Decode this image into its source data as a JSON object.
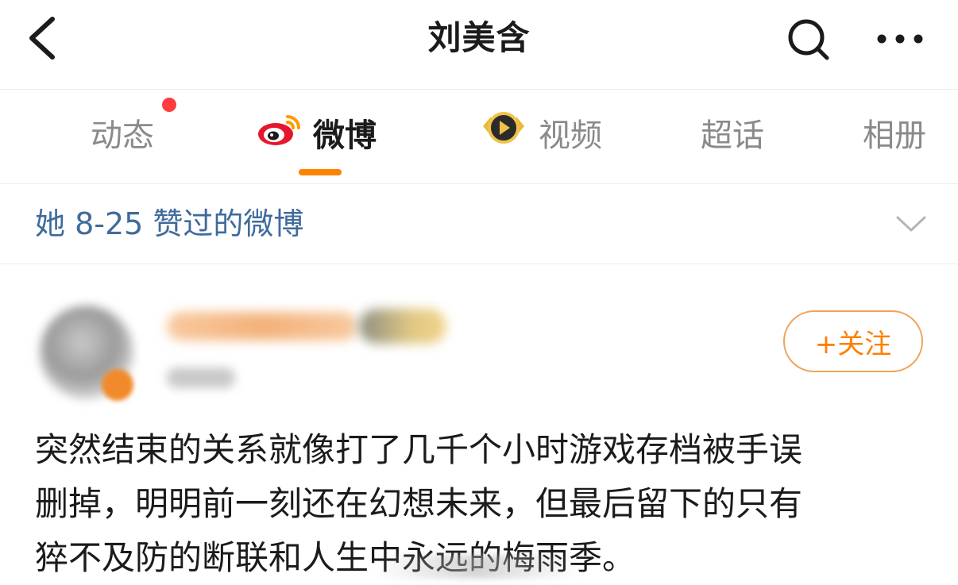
{
  "navbar": {
    "title": "刘美含",
    "back_icon": "chevron-left-icon",
    "search_icon": "search-icon",
    "more_icon": "more-dots-icon"
  },
  "tabs": [
    {
      "label": "动态",
      "active": false,
      "has_red_dot": true
    },
    {
      "label": "微博",
      "active": true,
      "icon": "weibo-logo-icon"
    },
    {
      "label": "视频",
      "active": false,
      "icon": "video-badge-icon"
    },
    {
      "label": "超话",
      "active": false
    },
    {
      "label": "相册",
      "active": false
    }
  ],
  "filter": {
    "label": "她 8-25 赞过的微博",
    "icon": "chevron-down-icon"
  },
  "post": {
    "follow_label": "+关注",
    "text_lines": [
      "突然结束的关系就像打了几千个小时游戏存档被手误",
      "删掉，明明前一刻还在幻想未来，但最后留下的只有",
      "猝不及防的断联和人生中永远的梅雨季。"
    ]
  },
  "colors": {
    "accent": "#ff8200",
    "link_blue": "#3f6b9b",
    "red_dot": "#ff3d3d",
    "follow_border": "#f0a35a"
  }
}
